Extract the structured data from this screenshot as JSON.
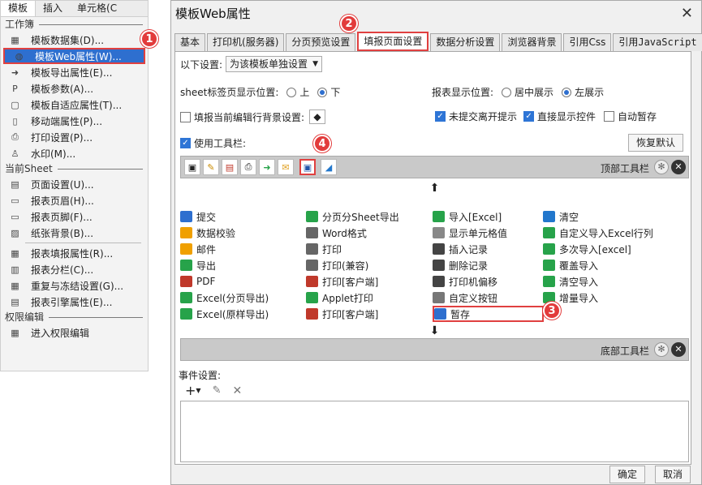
{
  "menu": {
    "tabs": [
      "模板",
      "插入",
      "单元格(C"
    ],
    "section_workbook": "工作簿",
    "section_sheet": "当前Sheet",
    "section_perm": "权限编辑",
    "workbook_items": [
      {
        "label": "模板数据集(D)...",
        "icon": "database-icon"
      },
      {
        "label": "模板Web属性(W)...",
        "icon": "globe-icon"
      },
      {
        "label": "模板导出属性(E)...",
        "icon": "export-icon"
      },
      {
        "label": "模板参数(A)...",
        "icon": "param-icon"
      },
      {
        "label": "模板自适应属性(T)...",
        "icon": "adaptive-icon"
      },
      {
        "label": "移动端属性(P)...",
        "icon": "mobile-icon"
      },
      {
        "label": "打印设置(P)...",
        "icon": "printer-icon"
      },
      {
        "label": "水印(M)...",
        "icon": "watermark-icon"
      }
    ],
    "sheet_items": [
      {
        "label": "页面设置(U)...",
        "icon": "page-setup-icon"
      },
      {
        "label": "报表页眉(H)...",
        "icon": "header-icon"
      },
      {
        "label": "报表页脚(F)...",
        "icon": "footer-icon"
      },
      {
        "label": "纸张背景(B)...",
        "icon": "background-icon"
      },
      {
        "label": "报表填报属性(R)...",
        "icon": "fill-attr-icon"
      },
      {
        "label": "报表分栏(C)...",
        "icon": "columns-icon"
      },
      {
        "label": "重复与冻结设置(G)...",
        "icon": "freeze-icon"
      },
      {
        "label": "报表引擎属性(E)...",
        "icon": "engine-icon"
      }
    ],
    "perm_items": [
      {
        "label": "进入权限编辑",
        "icon": "permission-icon"
      }
    ]
  },
  "badges": [
    "1",
    "2",
    "3",
    "4"
  ],
  "dialog": {
    "title": "模板Web属性",
    "close": "✕",
    "tabs": [
      "基本",
      "打印机(服务器)",
      "分页预览设置",
      "填报页面设置",
      "数据分析设置",
      "浏览器背景",
      "引用Css",
      "引用JavaScript"
    ],
    "setting_label": "以下设置:",
    "setting_value": "为该模板单独设置",
    "sheet_pos_label": "sheet标签页显示位置:",
    "sheet_pos_up": "上",
    "sheet_pos_down": "下",
    "report_pos_label": "报表显示位置:",
    "report_pos_center": "居中展示",
    "report_pos_left": "左展示",
    "fill_bg_label": "填报当前编辑行背景设置:",
    "unsubmitted_label": "未提交离开提示",
    "direct_show_label": "直接显示控件",
    "auto_save_label": "自动暂存",
    "use_toolbar_label": "使用工具栏:",
    "restore_default": "恢复默认",
    "top_toolbar": "顶部工具栏",
    "bottom_toolbar": "底部工具栏",
    "event_label": "事件设置:",
    "ok": "确定",
    "cancel": "取消",
    "grid": [
      [
        "提交",
        "分页分Sheet导出",
        "导入[Excel]",
        "清空"
      ],
      [
        "数据校验",
        "Word格式",
        "显示单元格值",
        "自定义导入Excel行列"
      ],
      [
        "邮件",
        "打印",
        "插入记录",
        "多次导入[excel]"
      ],
      [
        "导出",
        "打印(兼容)",
        "删除记录",
        "覆盖导入"
      ],
      [
        "PDF",
        "打印[客户端]",
        "打印机偏移",
        "清空导入"
      ],
      [
        "Excel(分页导出)",
        "Applet打印",
        "自定义按钮",
        "增量导入"
      ],
      [
        "Excel(原样导出)",
        "打印[客户端]",
        "暂存",
        ""
      ]
    ]
  }
}
